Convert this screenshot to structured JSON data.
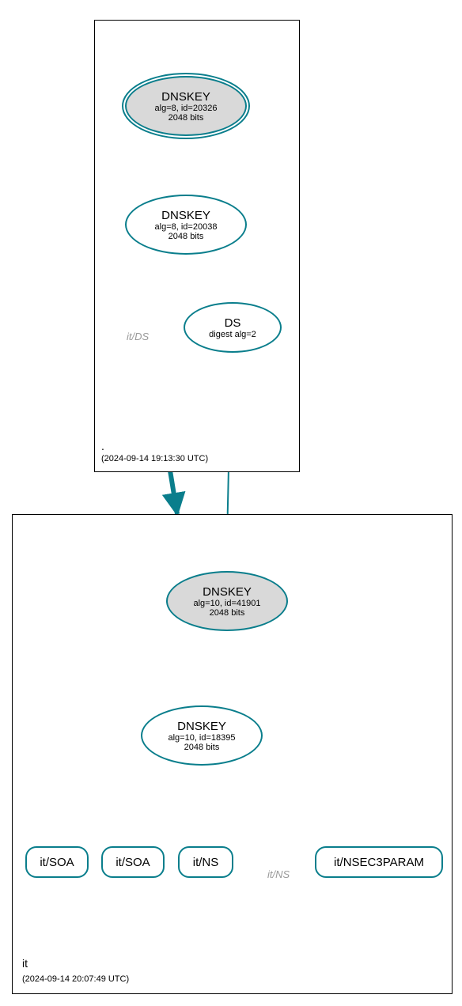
{
  "rootZone": {
    "label": ".",
    "timestamp": "(2024-09-14 19:13:30 UTC)",
    "ksk": {
      "title": "DNSKEY",
      "sub": "alg=8, id=20326",
      "bits": "2048 bits"
    },
    "zsk": {
      "title": "DNSKEY",
      "sub": "alg=8, id=20038",
      "bits": "2048 bits"
    },
    "ds": {
      "title": "DS",
      "sub": "digest alg=2"
    },
    "ds_missing_label": "it/DS"
  },
  "itZone": {
    "label": "it",
    "timestamp": "(2024-09-14 20:07:49 UTC)",
    "ksk": {
      "title": "DNSKEY",
      "sub": "alg=10, id=41901",
      "bits": "2048 bits"
    },
    "zsk": {
      "title": "DNSKEY",
      "sub": "alg=10, id=18395",
      "bits": "2048 bits"
    },
    "rrset1": "it/SOA",
    "rrset2": "it/SOA",
    "rrset3": "it/NS",
    "rrset4_missing": "it/NS",
    "rrset5": "it/NSEC3PARAM"
  }
}
